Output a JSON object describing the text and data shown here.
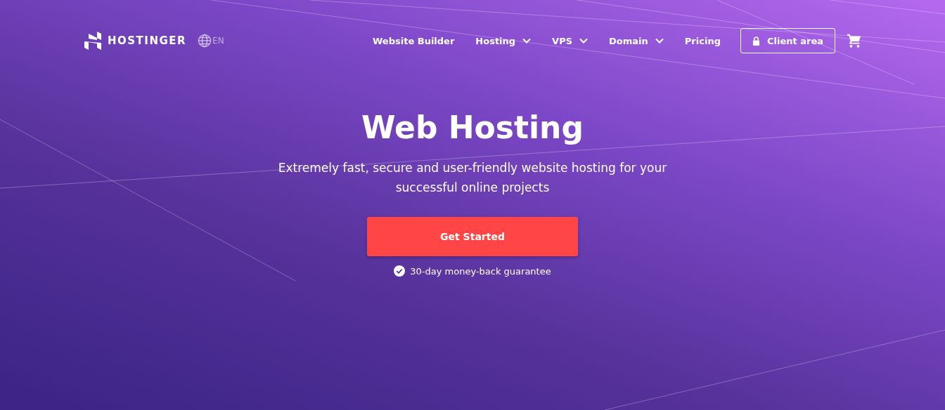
{
  "header": {
    "logo": "HOSTINGER",
    "language": "EN",
    "nav": [
      {
        "label": "Website Builder",
        "dropdown": false
      },
      {
        "label": "Hosting",
        "dropdown": true
      },
      {
        "label": "VPS",
        "dropdown": true
      },
      {
        "label": "Domain",
        "dropdown": true
      },
      {
        "label": "Pricing",
        "dropdown": false
      }
    ],
    "client_button": "Client area"
  },
  "hero": {
    "title": "Web Hosting",
    "subtitle": "Extremely fast, secure and user-friendly website hosting for your successful online projects",
    "cta": "Get Started",
    "guarantee": "30-day money-back guarantee"
  }
}
